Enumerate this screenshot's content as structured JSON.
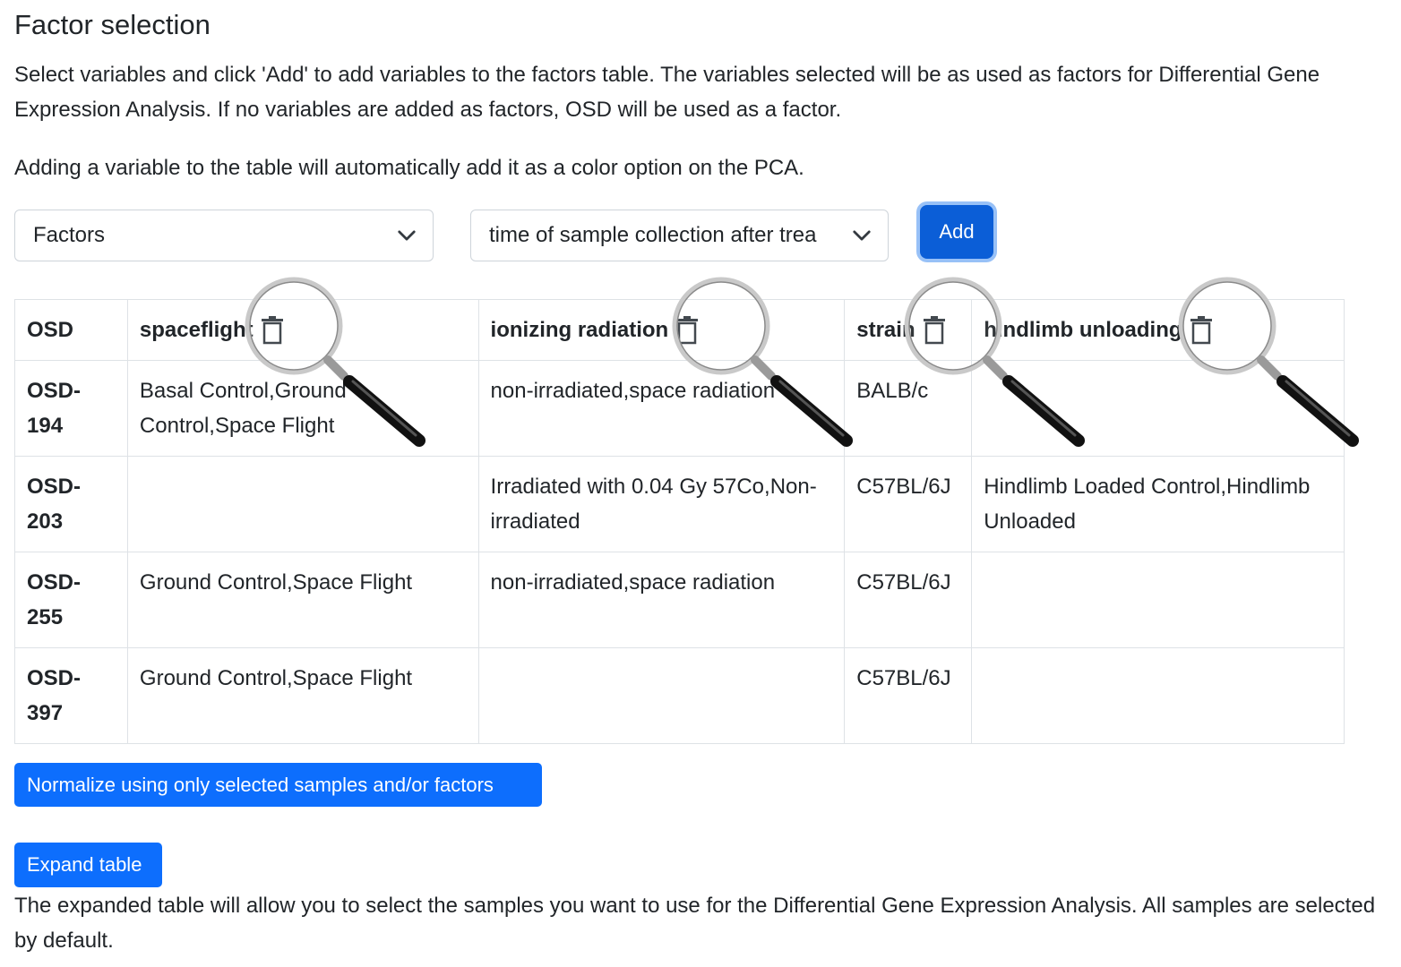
{
  "section": {
    "title": "Factor selection",
    "description": "Select variables and click 'Add' to add variables to the factors table. The variables selected will be as used as factors for Differential Gene Expression Analysis. If no variables are added as factors, OSD will be used as a factor.",
    "pca_note": "Adding a variable to the table will automatically add it as a color option on the PCA."
  },
  "controls": {
    "category_select": {
      "value": "Factors",
      "icon": "chevron-down-icon"
    },
    "variable_select": {
      "value": "time of sample collection after trea",
      "icon": "chevron-down-icon"
    },
    "add_label": "Add"
  },
  "table": {
    "columns": [
      {
        "label": "OSD",
        "deletable": false
      },
      {
        "label": "spaceflight",
        "deletable": true
      },
      {
        "label": "ionizing radiation",
        "deletable": true
      },
      {
        "label": "strain",
        "deletable": true
      },
      {
        "label": "hindlimb unloading",
        "deletable": true
      }
    ],
    "rows": [
      {
        "osd": "OSD-194",
        "spaceflight": "Basal Control,Ground Control,Space Flight",
        "ionizing_radiation": "non-irradiated,space radiation",
        "strain": "BALB/c",
        "hindlimb_unloading": ""
      },
      {
        "osd": "OSD-203",
        "spaceflight": "",
        "ionizing_radiation": "Irradiated with 0.04 Gy 57Co,Non-irradiated",
        "strain": "C57BL/6J",
        "hindlimb_unloading": "Hindlimb Loaded Control,Hindlimb Unloaded"
      },
      {
        "osd": "OSD-255",
        "spaceflight": "Ground Control,Space Flight",
        "ionizing_radiation": "non-irradiated,space radiation",
        "strain": "C57BL/6J",
        "hindlimb_unloading": ""
      },
      {
        "osd": "OSD-397",
        "spaceflight": "Ground Control,Space Flight",
        "ionizing_radiation": "",
        "strain": "C57BL/6J",
        "hindlimb_unloading": ""
      }
    ],
    "delete_icon": "trash-icon"
  },
  "actions": {
    "normalize_label": "Normalize using only selected samples and/or factors",
    "expand_label": "Expand table",
    "expand_note": "The expanded table will allow you to select the samples you want to use for the Differential Gene Expression Analysis. All samples are selected by default."
  },
  "colors": {
    "primary": "#0d6efd",
    "primary_dark": "#0b5ed7",
    "focus_ring": "#98c1f7",
    "border": "#dee2e6",
    "text": "#212529"
  },
  "overlays": {
    "icon": "magnifying-glass-icon"
  }
}
